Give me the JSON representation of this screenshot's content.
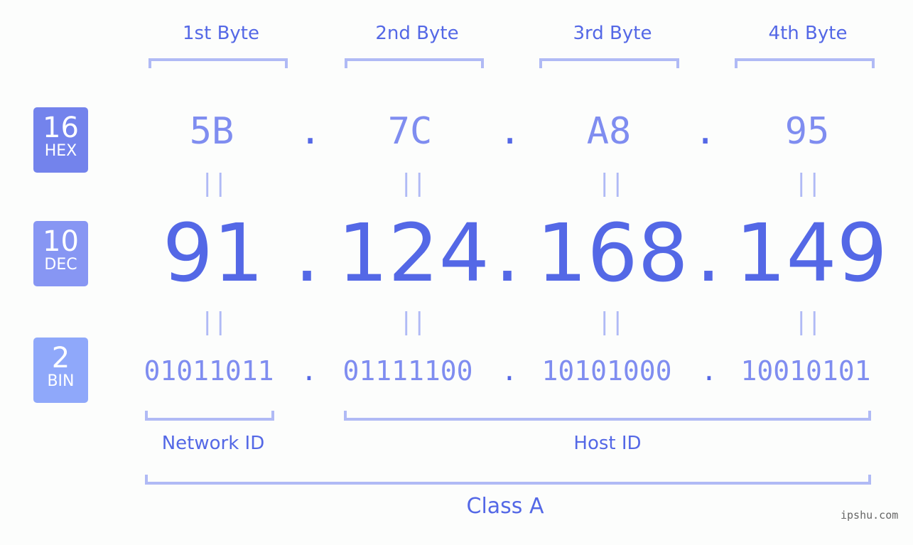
{
  "byte_headers": [
    "1st Byte",
    "2nd Byte",
    "3rd Byte",
    "4th Byte"
  ],
  "badges": [
    {
      "num": "16",
      "label": "HEX",
      "color": "#7383ec"
    },
    {
      "num": "10",
      "label": "DEC",
      "color": "#8796f3"
    },
    {
      "num": "2",
      "label": "BIN",
      "color": "#8fa8fa"
    }
  ],
  "ip": {
    "hex": [
      "5B",
      "7C",
      "A8",
      "95"
    ],
    "dec": [
      "91",
      "124",
      "168",
      "149"
    ],
    "bin": [
      "01011011",
      "01111100",
      "10101000",
      "10010101"
    ],
    "separator": ".",
    "equals": "||"
  },
  "segments": {
    "network_id": "Network ID",
    "host_id": "Host ID",
    "class": "Class A"
  },
  "watermark": "ipshu.com"
}
